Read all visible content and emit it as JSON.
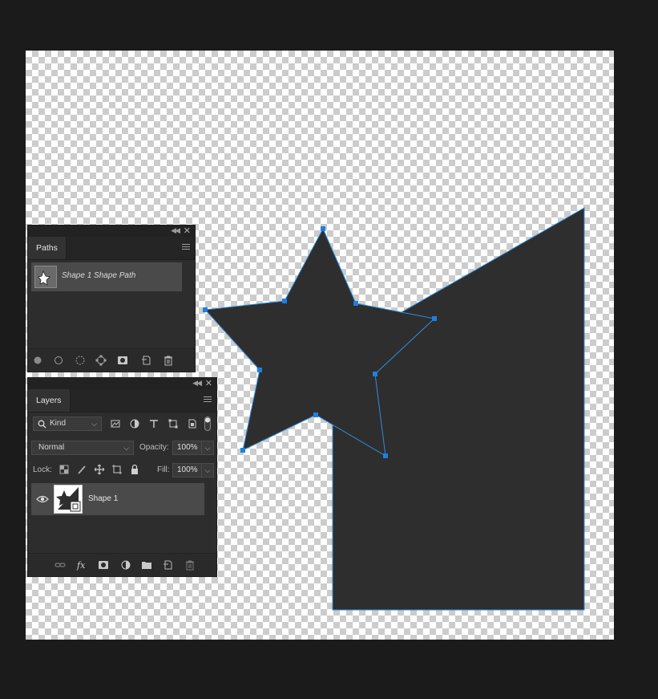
{
  "colors": {
    "app_background": "#1b1b1b",
    "panel_background": "#2d2d2d",
    "shape_fill": "#2e2e2e",
    "path_outline": "#2f8ee0",
    "anchor_point": "#1e7fe0",
    "selected_row": "#4a4a4a"
  },
  "canvas": {
    "content": "star and polygon shape on transparency grid",
    "shapes": [
      "star",
      "polygon"
    ],
    "anchor_icon": "anchor-point-square"
  },
  "paths_panel": {
    "tab_label": "Paths",
    "items": [
      {
        "label": "Shape 1 Shape Path",
        "icon": "path-thumbnail"
      }
    ],
    "footer_icons": [
      "fill-path-icon",
      "stroke-path-icon",
      "load-selection-icon",
      "make-work-path-icon",
      "add-mask-icon",
      "new-path-icon",
      "delete-path-icon"
    ]
  },
  "layers_panel": {
    "tab_label": "Layers",
    "filter": {
      "kind_value": "Kind",
      "icons": [
        "pixel-filter-icon",
        "adjustment-filter-icon",
        "type-filter-icon",
        "shape-filter-icon",
        "smart-object-filter-icon",
        "filter-toggle"
      ]
    },
    "blend_mode": "Normal",
    "opacity_label": "Opacity:",
    "opacity_value": "100%",
    "lock_label": "Lock:",
    "lock_icons": [
      "lock-transparent-icon",
      "lock-image-icon",
      "lock-position-icon",
      "lock-artboard-icon",
      "lock-all-icon"
    ],
    "fill_label": "Fill:",
    "fill_value": "100%",
    "layers": [
      {
        "name": "Shape 1",
        "visible": true,
        "type": "shape"
      }
    ],
    "footer_icons": [
      "link-layers-icon",
      "fx-icon",
      "add-mask-icon",
      "new-adjustment-icon",
      "new-group-icon",
      "new-layer-icon",
      "delete-layer-icon"
    ]
  }
}
